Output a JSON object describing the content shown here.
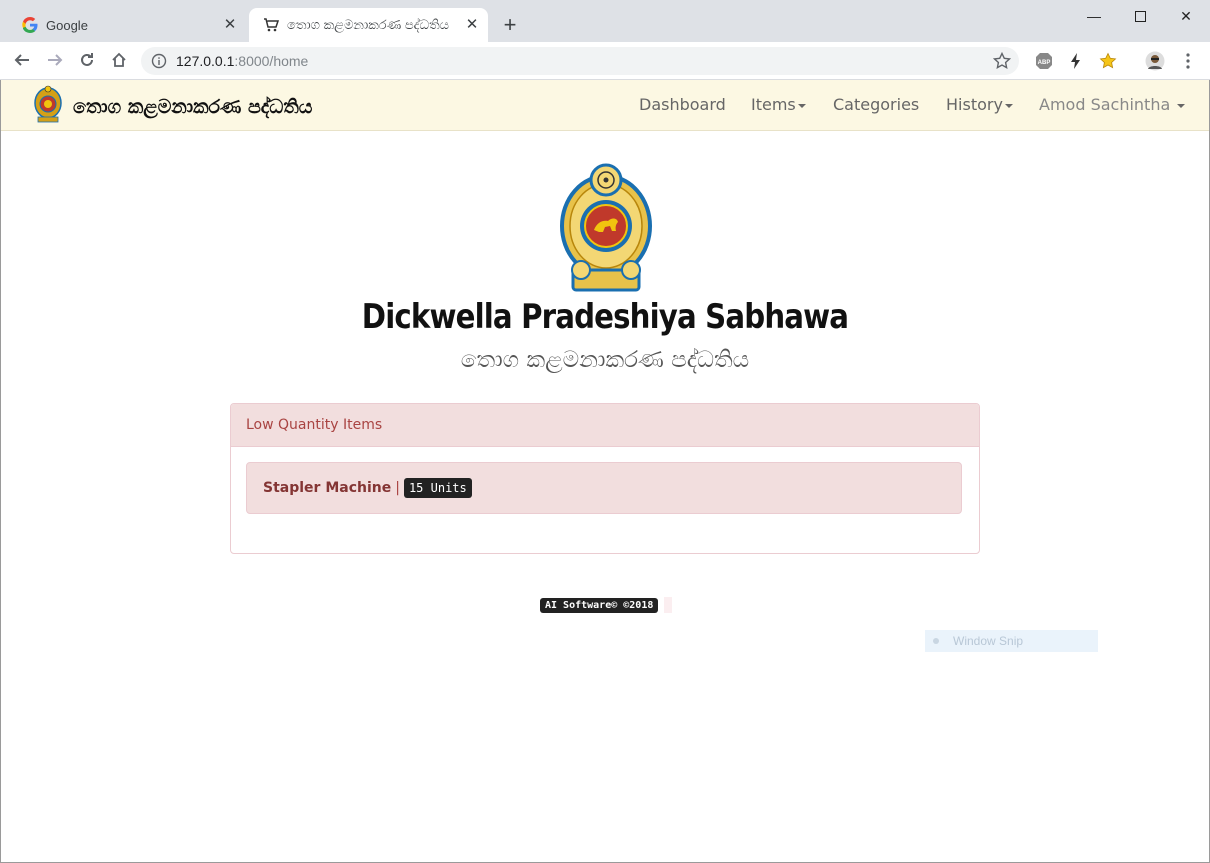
{
  "browser": {
    "tabs": [
      {
        "title": "Google",
        "active": false
      },
      {
        "title": "තොග කළමනාකරණ පද්ධතිය",
        "active": true
      }
    ],
    "new_tab_icon": "plus-icon",
    "url_host": "127.0.0.1",
    "url_rest": ":8000/home",
    "extensions": [
      "abp-icon",
      "bolt-icon",
      "star-ext-icon",
      "avatar-ext-icon",
      "more-vert-icon"
    ]
  },
  "navbar": {
    "brand_title": "තොග කළමනාකරණ පද්ධතිය",
    "links": {
      "dashboard": "Dashboard",
      "items": "Items",
      "categories": "Categories",
      "history": "History",
      "user": "Amod Sachintha"
    },
    "bg_color": "#fcf8e3"
  },
  "hero": {
    "organization": "Dickwella Pradeshiya Sabhawa",
    "subtitle": "තොග කළමනාකරණ පද්ධතිය"
  },
  "panel": {
    "heading": "Low Quantity Items",
    "items": [
      {
        "name": "Stapler Machine",
        "separator": "|",
        "quantity": "15 Units"
      }
    ],
    "colors": {
      "header_bg": "#f2dede",
      "text": "#a94442",
      "border": "#ebccd1"
    }
  },
  "footer": {
    "copyright": "AI Software© ©2018"
  },
  "overlay": {
    "window_snip": "Window Snip"
  }
}
